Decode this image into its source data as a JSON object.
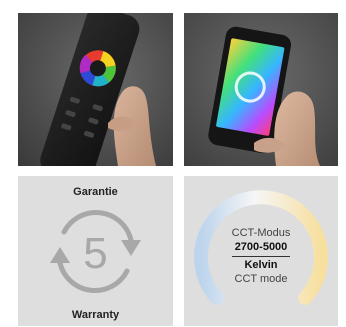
{
  "warranty": {
    "top_label": "Garantie",
    "number": "5",
    "bottom_label": "Warranty"
  },
  "cct": {
    "line1": "CCT-Modus",
    "range": "2700-5000",
    "unit": "Kelvin",
    "line4": "CCT mode"
  },
  "icons": [
    "remote-control-photo",
    "smartphone-photo",
    "circular-arrows-icon",
    "color-temperature-ring-icon"
  ]
}
